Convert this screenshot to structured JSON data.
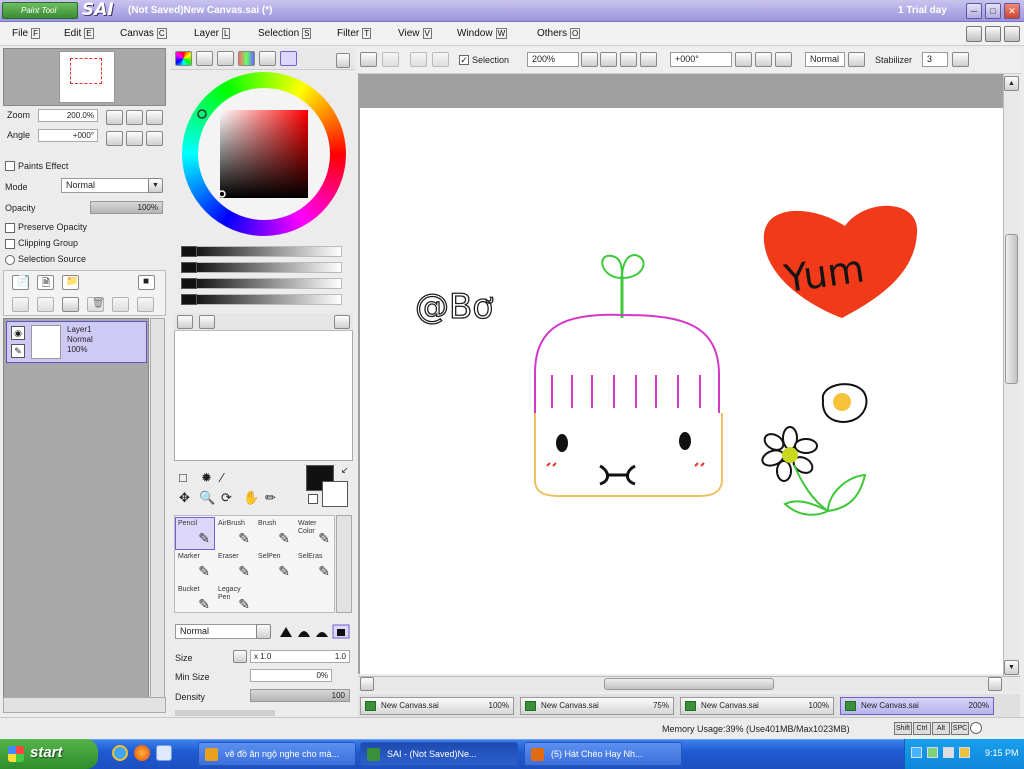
{
  "app": {
    "logo_text": "Paint Tool",
    "logo_name": "SAI",
    "title": "(Not Saved)New Canvas.sai (*)",
    "trial": "1 Trial day"
  },
  "menu": [
    {
      "label": "File",
      "key": "F"
    },
    {
      "label": "Edit",
      "key": "E"
    },
    {
      "label": "Canvas",
      "key": "C"
    },
    {
      "label": "Layer",
      "key": "L"
    },
    {
      "label": "Selection",
      "key": "S"
    },
    {
      "label": "Filter",
      "key": "T"
    },
    {
      "label": "View",
      "key": "V"
    },
    {
      "label": "Window",
      "key": "W"
    },
    {
      "label": "Others",
      "key": "O"
    }
  ],
  "navigator": {
    "zoom_label": "Zoom",
    "zoom_value": "200.0%",
    "angle_label": "Angle",
    "angle_value": "+000°"
  },
  "layer_props": {
    "paints_effect": "Paints Effect",
    "mode_label": "Mode",
    "mode_value": "Normal",
    "opacity_label": "Opacity",
    "opacity_value": "100%",
    "opacity_fraction": 1.0,
    "preserve_opacity": "Preserve Opacity",
    "clipping_group": "Clipping Group",
    "selection_source": "Selection Source"
  },
  "layers": [
    {
      "name": "Layer1",
      "mode": "Normal",
      "opacity": "100%"
    }
  ],
  "tools": [
    {
      "label": "Pencil",
      "selected": true
    },
    {
      "label": "AirBrush",
      "selected": false
    },
    {
      "label": "Brush",
      "selected": false
    },
    {
      "label": "Water Color",
      "selected": false
    },
    {
      "label": "Marker",
      "selected": false
    },
    {
      "label": "Eraser",
      "selected": false
    },
    {
      "label": "SelPen",
      "selected": false
    },
    {
      "label": "SelEras",
      "selected": false
    },
    {
      "label": "Bucket",
      "selected": false
    },
    {
      "label": "Legacy Pen",
      "selected": false
    }
  ],
  "brush": {
    "blend_mode": "Normal",
    "size_label": "Size",
    "size_mult": "x 1.0",
    "size_value": "1.0",
    "min_size_label": "Min Size",
    "min_size_value": "0%",
    "density_label": "Density",
    "density_value": "100",
    "density_fraction": 1.0
  },
  "canvas_toolbar": {
    "selection_label": "Selection",
    "zoom": "200%",
    "angle": "+000°",
    "blend": "Normal",
    "stabilizer_label": "Stabilizer",
    "stabilizer_value": "3"
  },
  "artwork": {
    "watermark": "@Bơ",
    "heart_text": "Yum",
    "heart_color": "#f03a1a",
    "character_outline": "#d438c8",
    "character_bottom": "#f0c060",
    "sprout_color": "#3ec83a"
  },
  "doc_tabs": [
    {
      "label": "New Canvas.sai",
      "zoom": "100%",
      "active": false
    },
    {
      "label": "New Canvas.sai",
      "zoom": "75%",
      "active": false
    },
    {
      "label": "New Canvas.sai",
      "zoom": "100%",
      "active": false
    },
    {
      "label": "New Canvas.sai",
      "zoom": "200%",
      "active": true
    }
  ],
  "status": {
    "memory": "Memory Usage:39% (Use401MB/Max1023MB)",
    "keys": [
      "Shift",
      "Ctrl",
      "Alt",
      "SPC"
    ]
  },
  "taskbar": {
    "start_label": "start",
    "items": [
      {
        "label": "vẽ đồ ăn ngộ nghe cho mà...",
        "active": false,
        "icon_color": "#e8a020"
      },
      {
        "label": "SAI - (Not Saved)Ne...",
        "active": true,
        "icon_color": "#3b8f3a"
      },
      {
        "label": "(5) Hát Chèo Hay Nh...",
        "active": false,
        "icon_color": "#e26a10"
      }
    ],
    "clock": "9:15 PM"
  },
  "colors": {
    "selection_accent": "#6b63d0",
    "title_bar": "#9d95dc",
    "taskbar": "#245edb"
  }
}
